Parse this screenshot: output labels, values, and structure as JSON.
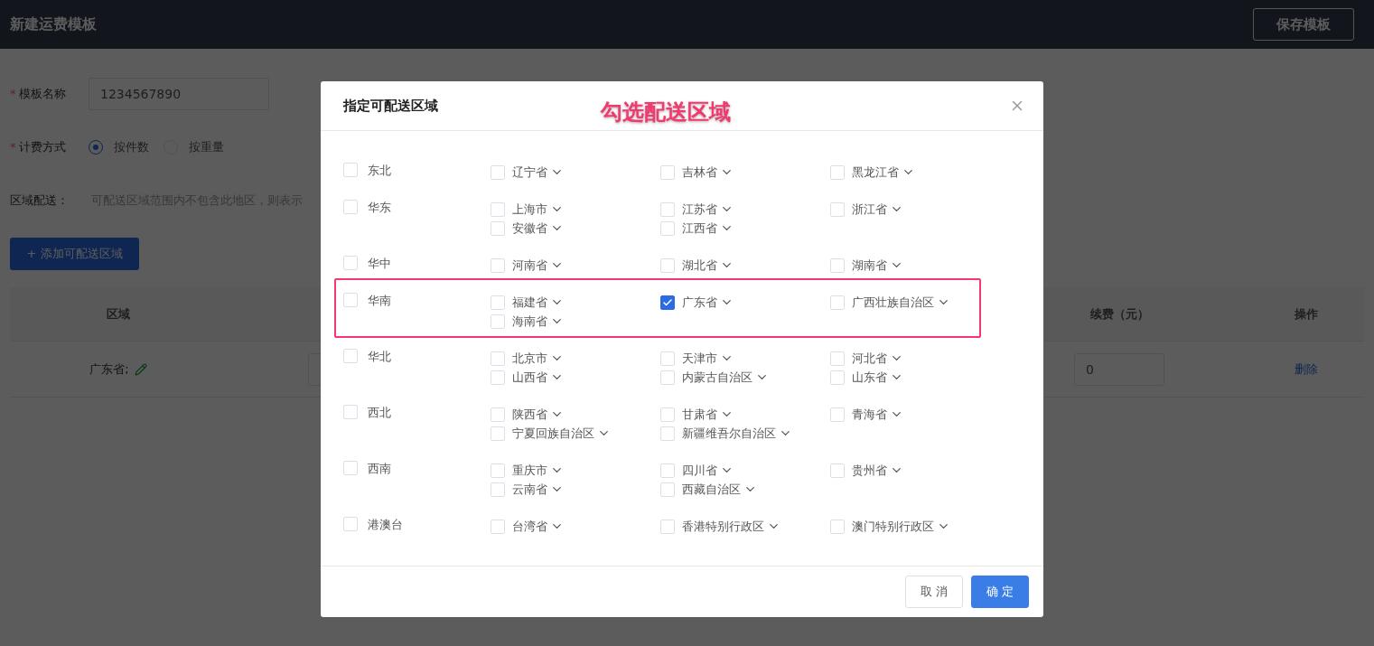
{
  "header": {
    "title": "新建运费模板",
    "save_button": "保存模板"
  },
  "form": {
    "name_mark": "*",
    "name_label": "模板名称",
    "billing_mark": "*",
    "name_value": "1234567890",
    "billing_label": "计费方式",
    "billing_options": [
      {
        "label": "按件数",
        "selected": true
      },
      {
        "label": "按重量",
        "selected": false
      }
    ],
    "area_label": "区域配送：",
    "area_hint": "可配送区域范围内不包含此地区，则表示",
    "add_button": "+ 添加可配送区域"
  },
  "table": {
    "columns": [
      "区域",
      "续费（元）",
      "操作"
    ],
    "rows": [
      {
        "region": "广东省;",
        "renewal_fee": "0",
        "action": "删除"
      }
    ]
  },
  "dialog": {
    "title": "指定可配送区域",
    "annotation": "勾选配送区域",
    "groups": [
      {
        "name": "东北",
        "checked": false,
        "highlighted": false,
        "provinces": [
          {
            "name": "辽宁省",
            "checked": false
          },
          {
            "name": "吉林省",
            "checked": false
          },
          {
            "name": "黑龙江省",
            "checked": false
          }
        ]
      },
      {
        "name": "华东",
        "checked": false,
        "highlighted": false,
        "provinces": [
          {
            "name": "上海市",
            "checked": false
          },
          {
            "name": "江苏省",
            "checked": false
          },
          {
            "name": "浙江省",
            "checked": false
          },
          {
            "name": "安徽省",
            "checked": false
          },
          {
            "name": "江西省",
            "checked": false
          }
        ]
      },
      {
        "name": "华中",
        "checked": false,
        "highlighted": false,
        "provinces": [
          {
            "name": "河南省",
            "checked": false
          },
          {
            "name": "湖北省",
            "checked": false
          },
          {
            "name": "湖南省",
            "checked": false
          }
        ]
      },
      {
        "name": "华南",
        "checked": false,
        "highlighted": true,
        "provinces": [
          {
            "name": "福建省",
            "checked": false
          },
          {
            "name": "广东省",
            "checked": true
          },
          {
            "name": "广西壮族自治区",
            "checked": false
          },
          {
            "name": "海南省",
            "checked": false
          }
        ]
      },
      {
        "name": "华北",
        "checked": false,
        "highlighted": false,
        "provinces": [
          {
            "name": "北京市",
            "checked": false
          },
          {
            "name": "天津市",
            "checked": false
          },
          {
            "name": "河北省",
            "checked": false
          },
          {
            "name": "山西省",
            "checked": false
          },
          {
            "name": "内蒙古自治区",
            "checked": false
          },
          {
            "name": "山东省",
            "checked": false
          }
        ]
      },
      {
        "name": "西北",
        "checked": false,
        "highlighted": false,
        "provinces": [
          {
            "name": "陕西省",
            "checked": false
          },
          {
            "name": "甘肃省",
            "checked": false
          },
          {
            "name": "青海省",
            "checked": false
          },
          {
            "name": "宁夏回族自治区",
            "checked": false
          },
          {
            "name": "新疆维吾尔自治区",
            "checked": false
          }
        ]
      },
      {
        "name": "西南",
        "checked": false,
        "highlighted": false,
        "provinces": [
          {
            "name": "重庆市",
            "checked": false
          },
          {
            "name": "四川省",
            "checked": false
          },
          {
            "name": "贵州省",
            "checked": false
          },
          {
            "name": "云南省",
            "checked": false
          },
          {
            "name": "西藏自治区",
            "checked": false
          }
        ]
      },
      {
        "name": "港澳台",
        "checked": false,
        "highlighted": false,
        "provinces": [
          {
            "name": "台湾省",
            "checked": false
          },
          {
            "name": "香港特别行政区",
            "checked": false
          },
          {
            "name": "澳门特别行政区",
            "checked": false
          }
        ]
      }
    ],
    "buttons": [
      {
        "label": "取 消",
        "kind": "default"
      },
      {
        "label": "确 定",
        "kind": "primary"
      }
    ]
  }
}
